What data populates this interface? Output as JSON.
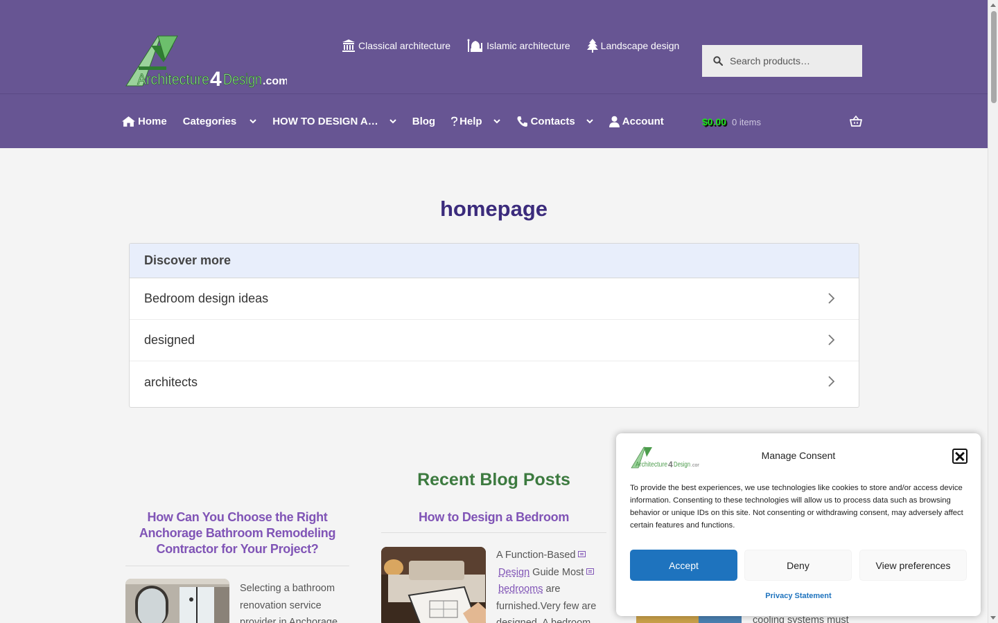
{
  "site": {
    "logo_text": "Architecture4Design.com"
  },
  "toplinks": [
    {
      "label": "Classical architecture",
      "icon": "institution-icon"
    },
    {
      "label": "Islamic architecture",
      "icon": "mosque-icon"
    },
    {
      "label": "Landscape design",
      "icon": "tree-icon"
    }
  ],
  "search": {
    "placeholder": "Search products…"
  },
  "nav": [
    {
      "label": "Home",
      "icon": "home-icon",
      "dropdown": false
    },
    {
      "label": "Categories",
      "dropdown": true
    },
    {
      "label": "HOW TO DESIGN A…",
      "dropdown": true
    },
    {
      "label": "Blog",
      "dropdown": false
    },
    {
      "label": "Help",
      "icon": "question-icon",
      "dropdown": true
    },
    {
      "label": "Contacts",
      "icon": "phone-icon",
      "dropdown": true
    },
    {
      "label": "Account",
      "icon": "user-icon",
      "dropdown": false
    }
  ],
  "cart": {
    "amount": "$0.00",
    "count": "0 items",
    "icon": "basket-icon"
  },
  "page": {
    "title": "homepage"
  },
  "discover": {
    "heading": "Discover more",
    "items": [
      "Bedroom design ideas",
      "designed",
      "architects"
    ]
  },
  "blog": {
    "heading": "Recent Blog Posts",
    "posts": [
      {
        "title": "How Can You Choose the Right Anchorage Bathroom Remodeling Contractor for Your Project?",
        "excerpt_lines": [
          "Selecting a bathroom",
          "renovation service",
          "provider in Anchorage"
        ]
      },
      {
        "title": "How to Design a Bedroom",
        "excerpt": {
          "prefix": "A Function-Based",
          "kw1": "Design",
          "mid": "Guide Most",
          "kw2": "bedrooms",
          "after": "are",
          "line4": "furnished.Very few are",
          "line5": "designed. A bedroom"
        }
      },
      {
        "excerpt_lines": [
          "cooling systems must"
        ]
      }
    ]
  },
  "consent": {
    "title": "Manage Consent",
    "body": "To provide the best experiences, we use technologies like cookies to store and/or access device information. Consenting to these technologies will allow us to process data such as browsing behavior or unique IDs on this site. Not consenting or withdrawing consent, may adversely affect certain features and functions.",
    "accept": "Accept",
    "deny": "Deny",
    "preferences": "View preferences",
    "privacy": "Privacy Statement"
  },
  "colors": {
    "header": "#675593",
    "title": "#3b2b7c",
    "blog_heading": "#3c7a3f",
    "post_title": "#8054b6",
    "cart_amount": "#1fe51f",
    "accept_button": "#1e73be"
  }
}
